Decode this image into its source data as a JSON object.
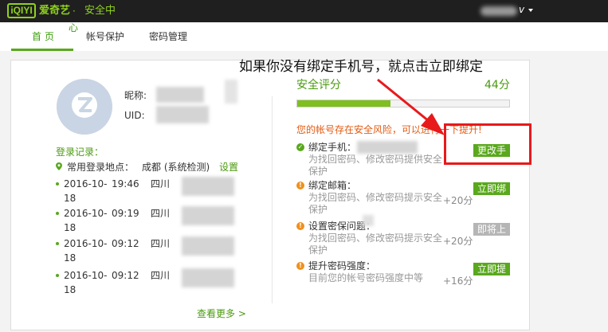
{
  "header": {
    "logo_text": "iQIYI",
    "brand": "爱奇艺",
    "separator": "·",
    "subtitle": "安全中",
    "user_suffix": "v"
  },
  "nav": {
    "floating_char": "心",
    "tabs": [
      {
        "label": "首 页",
        "active": true
      },
      {
        "label": "帐号保护",
        "active": false
      },
      {
        "label": "密码管理",
        "active": false
      }
    ]
  },
  "profile": {
    "nickname_label": "昵称:",
    "uid_label": "UID:"
  },
  "login_records": {
    "title": "登录记录：",
    "common_location_label": "常用登录地点：",
    "common_location_value": "成都 (系统检测)",
    "set_link": "设置",
    "records": [
      {
        "date": "2016-10-18",
        "time": "19:46",
        "province": "四川"
      },
      {
        "date": "2016-10-18",
        "time": "09:19",
        "province": "四川"
      },
      {
        "date": "2016-10-18",
        "time": "09:12",
        "province": "四川"
      },
      {
        "date": "2016-10-18",
        "time": "09:12",
        "province": "四川"
      }
    ],
    "more_link": "查看更多 >"
  },
  "security": {
    "title": "安全评分",
    "score": "44分",
    "progress": 0.44,
    "risk_text": "您的帐号存在安全风险，可以进行一下提升!",
    "items": [
      {
        "status": "ok",
        "title": "绑定手机：",
        "desc": "为找回密码、修改密码提供安全保护",
        "points": "",
        "button": "更改手"
      },
      {
        "status": "warn",
        "title": "绑定邮箱：",
        "desc": "为找回密码、修改密码提示安全保护",
        "points": "+20分",
        "button": "立即绑"
      },
      {
        "status": "warn",
        "title": "设置密保问题：",
        "desc": "为找回密码、修改密码提示安全保护",
        "points": "+20分",
        "button": "即将上"
      },
      {
        "status": "warn",
        "title": "提升密码强度：",
        "desc": "目前您的帐号密码强度中等",
        "points": "+16分",
        "button": "立即提"
      }
    ]
  },
  "annotation": {
    "text": "如果你没有绑定手机号，就点击立即绑定"
  },
  "colors": {
    "brand_green": "#8fd11f",
    "accent_green": "#5aa81d",
    "risk_orange": "#e35a12",
    "annotation_red": "#e8191b"
  }
}
